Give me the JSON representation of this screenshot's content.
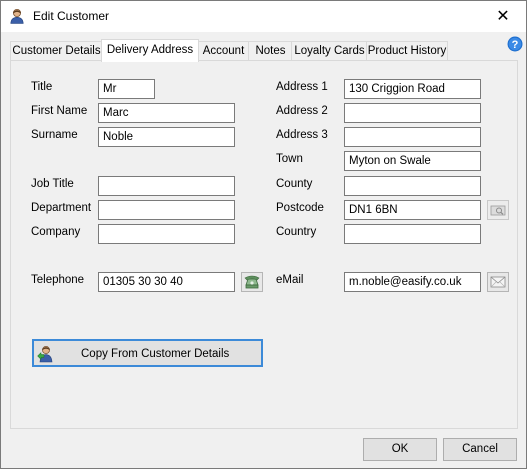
{
  "window": {
    "title": "Edit Customer",
    "close_glyph": "✕"
  },
  "tabs": [
    {
      "label": "Customer Details"
    },
    {
      "label": "Delivery Address"
    },
    {
      "label": "Account"
    },
    {
      "label": "Notes"
    },
    {
      "label": "Loyalty Cards"
    },
    {
      "label": "Product History"
    }
  ],
  "active_tab": "Delivery Address",
  "left_fields": {
    "title": {
      "label": "Title",
      "value": "Mr"
    },
    "first_name": {
      "label": "First Name",
      "value": "Marc"
    },
    "surname": {
      "label": "Surname",
      "value": "Noble"
    },
    "job_title": {
      "label": "Job Title",
      "value": ""
    },
    "department": {
      "label": "Department",
      "value": ""
    },
    "company": {
      "label": "Company",
      "value": ""
    },
    "telephone": {
      "label": "Telephone",
      "value": "01305 30 30 40"
    }
  },
  "right_fields": {
    "address1": {
      "label": "Address 1",
      "value": "130 Criggion Road"
    },
    "address2": {
      "label": "Address 2",
      "value": ""
    },
    "address3": {
      "label": "Address 3",
      "value": ""
    },
    "town": {
      "label": "Town",
      "value": "Myton on Swale"
    },
    "county": {
      "label": "County",
      "value": ""
    },
    "postcode": {
      "label": "Postcode",
      "value": "DN1 6BN"
    },
    "country": {
      "label": "Country",
      "value": ""
    },
    "email": {
      "label": "eMail",
      "value": "m.noble@easify.co.uk"
    }
  },
  "copy_button": {
    "label": "Copy From Customer Details",
    "icon": "customer-copy-icon"
  },
  "footer": {
    "ok": "OK",
    "cancel": "Cancel"
  },
  "icons": {
    "title": "customer-icon",
    "help": "help-icon",
    "phone": "phone-icon",
    "email": "envelope-icon",
    "postcode_lookup": "postcode-lookup-icon"
  },
  "colors": {
    "accent": "#3c8ad8",
    "help_blue": "#1e6fcf"
  }
}
